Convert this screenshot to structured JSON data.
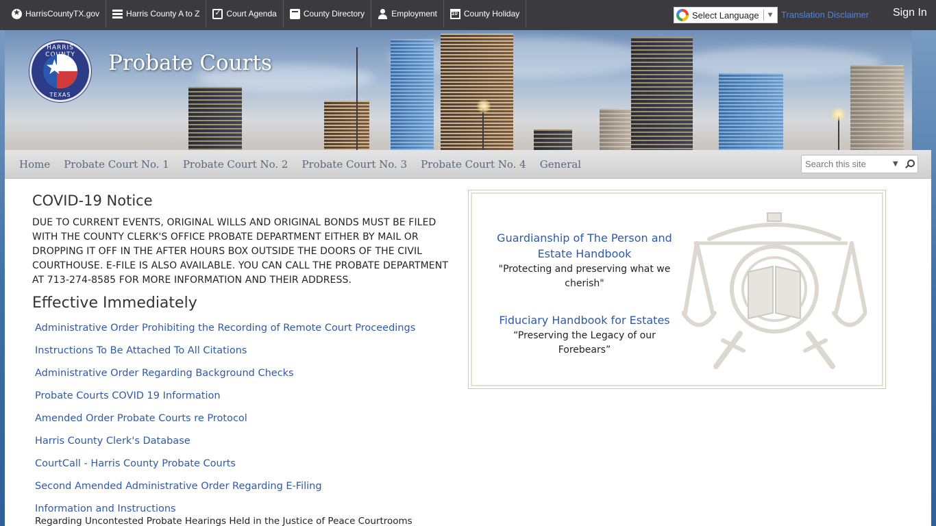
{
  "topnav": {
    "items": [
      {
        "label": "HarrisCountyTX.gov",
        "icon": "star-circle-icon"
      },
      {
        "label": "Harris County A to Z",
        "icon": "list-icon"
      },
      {
        "label": "Court Agenda",
        "icon": "clipboard-check-icon"
      },
      {
        "label": "County Directory",
        "icon": "book-icon"
      },
      {
        "label": "Employment",
        "icon": "user-icon"
      },
      {
        "label": "County Holiday",
        "icon": "calendar-icon"
      }
    ],
    "language_select": "Select Language",
    "translation_disclaimer": "Translation Disclaimer",
    "sign_in": "Sign In"
  },
  "header": {
    "seal_top": "HARRIS COUNTY",
    "seal_bottom": "TEXAS",
    "site_title": "Probate Courts"
  },
  "nav": {
    "items": [
      "Home",
      "Probate Court No. 1",
      "Probate Court No. 2",
      "Probate Court No. 3",
      "Probate Court No. 4",
      "General"
    ],
    "search_placeholder": "Search this site"
  },
  "main": {
    "notice_title": "COVID-19 Notice",
    "notice_body": "DUE TO CURRENT EVENTS, ORIGINAL WILLS AND ORIGINAL BONDS MUST BE FILED WITH THE COUNTY CLERK'S OFFICE PROBATE DEPARTMENT EITHER BY MAIL OR DROPPING IT OFF IN THE AFTER HOURS BOX OUTSIDE THE DOORS OF THE CIVIL COURTHOUSE. E-FILE IS ALSO AVAILABLE.  YOU CAN CALL THE PROBATE DEPARTMENT AT 713-274-8585 FOR MORE INFORMATION AND THEIR ADDRESS.",
    "effective_title": "Effective Immediately",
    "links": [
      "Administrative Order Prohibiting the Recording of Remote Court Proceedings",
      "Instructions To Be Attached To All Citations",
      "Administrative Order Regarding Background Checks",
      "Probate Courts COVID 19 Information",
      "Amended Order Probate Courts re Protocol",
      "Harris County Clerk's Database",
      "CourtCall - Harris County Probate Courts",
      "Second Amended Administrative Order Regarding E-Filing",
      "Information and Instructions"
    ],
    "last_link_subtext": "Regarding Uncontested Probate Hearings Held in the Justice of Peace Courtrooms"
  },
  "feature": {
    "card1_title": "Guardianship of The Person and Estate Handbook",
    "card1_text": "\"Protecting and preserving what we cherish\"",
    "card2_title": "Fiduciary Handbook for Estates",
    "card2_text": "“Preserving the Legacy of our Forebears”"
  },
  "colors": {
    "topbar": "#3a3a3f",
    "link": "#2f5aa8",
    "nav_text": "#5a6a7c",
    "translation_link": "#4a86e8"
  }
}
